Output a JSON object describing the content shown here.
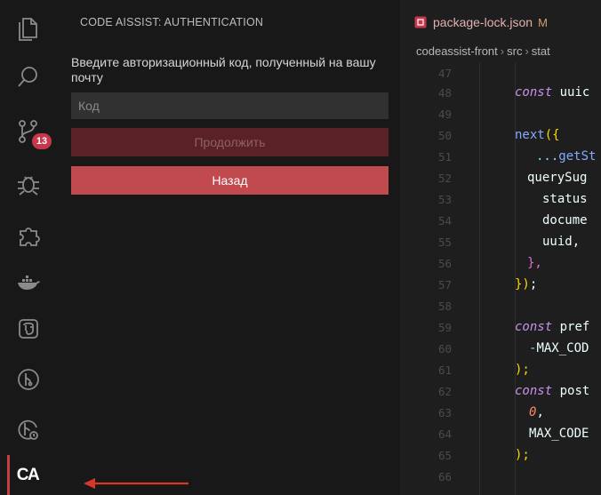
{
  "activity_bar": {
    "icons": [
      "files-icon",
      "search-icon",
      "source-control-icon",
      "debug-icon",
      "extensions-icon",
      "docker-icon",
      "database-icon",
      "git-graph-icon",
      "git-history-icon",
      "git-lens-icon",
      "code-assist-icon"
    ],
    "source_control_badge": "13",
    "code_assist_label": "CA"
  },
  "side_panel": {
    "title": "CODE AISSIST: AUTHENTICATION",
    "instruction": "Введите авторизационный код, полученный на вашу почту",
    "code_placeholder": "Код",
    "code_value": "",
    "continue_label": "Продолжить",
    "back_label": "Назад"
  },
  "editor": {
    "tab_name": "package-lock.json",
    "tab_status": "M",
    "breadcrumb": [
      "codeassist-front",
      "src",
      "stat"
    ],
    "line_numbers": [
      "47",
      "48",
      "49",
      "50",
      "51",
      "52",
      "53",
      "54",
      "55",
      "56",
      "57",
      "58",
      "59",
      "60",
      "61",
      "62",
      "63",
      "64",
      "65",
      "66"
    ],
    "code_lines": {
      "48": {
        "kw": "const",
        "rest": " uuic"
      },
      "50": {
        "fn": "next",
        "open": "({"
      },
      "51": {
        "spread": "...",
        "rest": "getSt"
      },
      "52": {
        "rest": "querySug"
      },
      "53": {
        "rest": "status"
      },
      "54": {
        "rest": "docume"
      },
      "55": {
        "rest": "uuid,"
      },
      "56": {
        "close": "},"
      },
      "57": {
        "close1": "})",
        "end": ";"
      },
      "59": {
        "kw": "const",
        "rest": " pref"
      },
      "60": {
        "minus": "-",
        "rest": "MAX_COD"
      },
      "61": {
        "close": ");"
      },
      "62": {
        "kw": "const",
        "rest": " post"
      },
      "63": {
        "num": "0",
        "end": ","
      },
      "64": {
        "rest": "MAX_CODE"
      },
      "65": {
        "close": ");"
      }
    }
  },
  "colors": {
    "accent_red": "#c14a4f",
    "badge_red": "#c5384a",
    "arrow_red": "#d9362b"
  }
}
